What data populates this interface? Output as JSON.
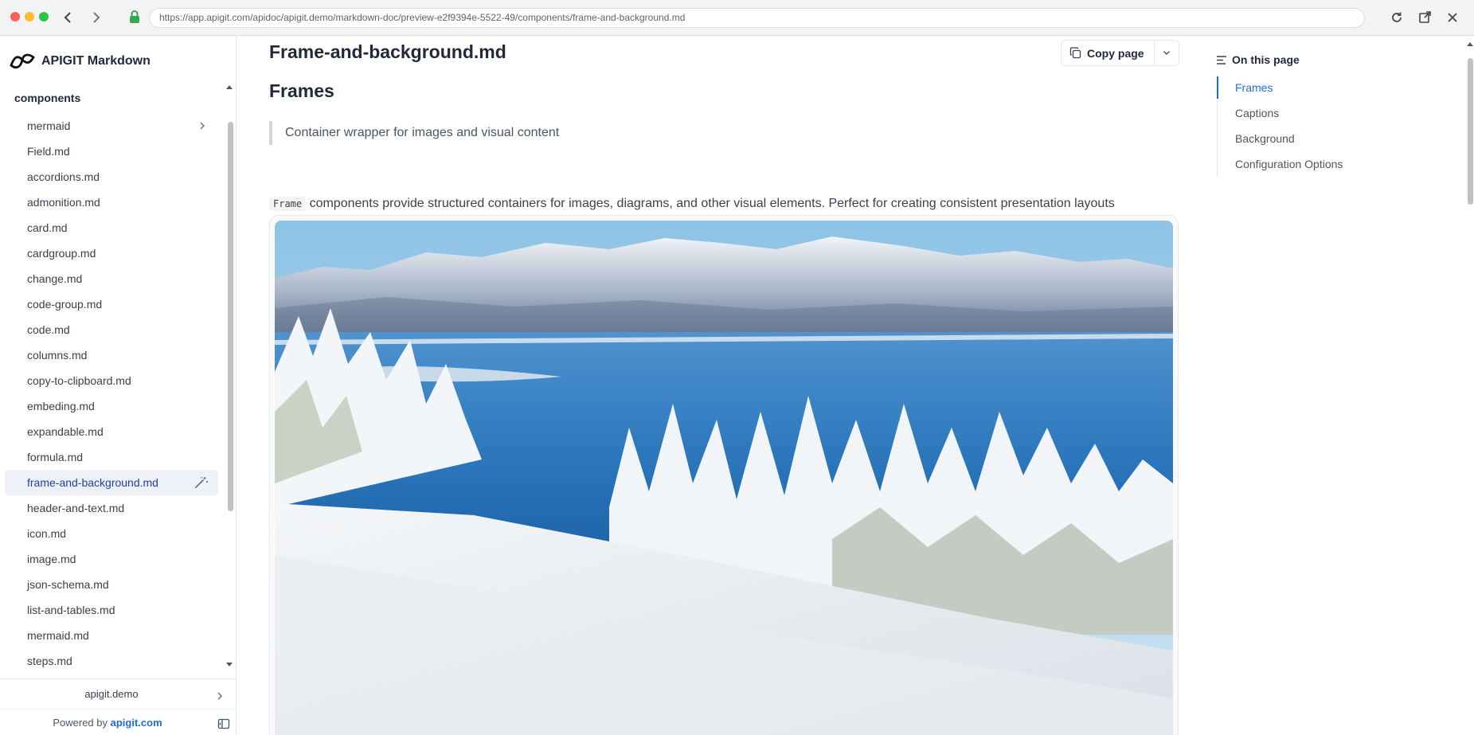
{
  "browser": {
    "url": "https://app.apigit.com/apidoc/apigit.demo/markdown-doc/preview-e2f9394e-5522-49/components/frame-and-background.md"
  },
  "sidebar": {
    "brand": "APIGIT Markdown",
    "section": "components",
    "items": [
      {
        "label": "mermaid",
        "has_children": true
      },
      {
        "label": "Field.md"
      },
      {
        "label": "accordions.md"
      },
      {
        "label": "admonition.md"
      },
      {
        "label": "card.md"
      },
      {
        "label": "cardgroup.md"
      },
      {
        "label": "change.md"
      },
      {
        "label": "code-group.md"
      },
      {
        "label": "code.md"
      },
      {
        "label": "columns.md"
      },
      {
        "label": "copy-to-clipboard.md"
      },
      {
        "label": "embeding.md"
      },
      {
        "label": "expandable.md"
      },
      {
        "label": "formula.md"
      },
      {
        "label": "frame-and-background.md",
        "active": true
      },
      {
        "label": "header-and-text.md"
      },
      {
        "label": "icon.md"
      },
      {
        "label": "image.md"
      },
      {
        "label": "json-schema.md"
      },
      {
        "label": "list-and-tables.md"
      },
      {
        "label": "mermaid.md"
      },
      {
        "label": "steps.md"
      }
    ],
    "org": "apigit.demo",
    "powered_prefix": "Powered by",
    "powered_link": "apigit.com"
  },
  "main": {
    "page_title": "Frame-and-background.md",
    "copy_label": "Copy page",
    "heading": "Frames",
    "blockquote": "Container wrapper for images and visual content",
    "code_token": "Frame",
    "paragraph": "components provide structured containers for images, diagrams, and other visual elements. Perfect for creating consistent presentation layouts with optional styling and captions.",
    "image_subject": "snowy mountain lake landscape"
  },
  "toc": {
    "title": "On this page",
    "items": [
      {
        "label": "Frames",
        "active": true
      },
      {
        "label": "Captions"
      },
      {
        "label": "Background"
      },
      {
        "label": "Configuration Options"
      }
    ]
  },
  "colors": {
    "accent": "#1d6fd8",
    "active_bg": "#eef1f7",
    "active_text": "#1e40af"
  }
}
